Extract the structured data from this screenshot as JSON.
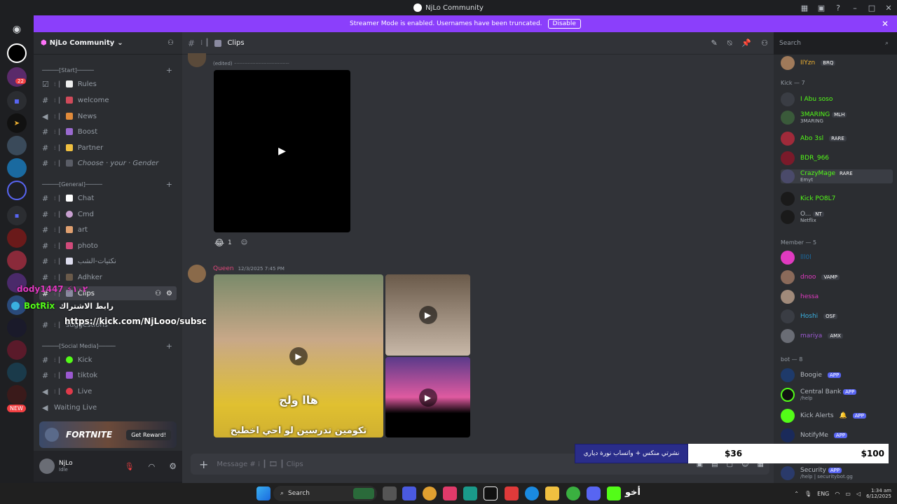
{
  "window": {
    "title": "NjLo Community"
  },
  "banner": {
    "text": "Streamer Mode is enabled. Usernames have been truncated.",
    "button": "Disable"
  },
  "server": {
    "name": "NjLo Community"
  },
  "categories": {
    "start": "─────[Start]─────",
    "general": "─────[General]─────",
    "social": "─────[Social Media]─────"
  },
  "channels": {
    "rules": "Rules",
    "welcome": "welcome",
    "news": "News",
    "boost": "Boost",
    "partner": "Partner",
    "choose": "Choose · your · Gender",
    "chat": "Chat",
    "cmd": "Cmd",
    "art": "art",
    "photo": "photo",
    "memes": "نكتيات-الشب",
    "adhker": "Adhker",
    "clips": "Clips",
    "suggestions": "suggestions",
    "kick": "Kick",
    "tiktok": "tiktok",
    "live": "Live",
    "waiting": "Waiting Live"
  },
  "promo": {
    "game": "FORTNITE",
    "button": "Get Reward!"
  },
  "user": {
    "name": "NjLo",
    "status": "Idle"
  },
  "header": {
    "channel": "Clips"
  },
  "search": {
    "placeholder": "Search"
  },
  "messages": {
    "edited": "(edited)",
    "reaction_count": "1",
    "author": "Queen",
    "timestamp": "12/3/2025 7:45 PM",
    "arabic_caption": "هاا ولج",
    "arabic_caption2": "تكومين تدرسين لو احي اخطبح"
  },
  "compose": {
    "placeholder": "Message # ⁞ ┃ 🎞 ┃ Clips"
  },
  "stream_overlay": {
    "user1": "dody1447 ⚡١٠٢",
    "user2": "BotRix",
    "user2_label": "رابط الاشتراك",
    "link": "https://kick.com/NjLooo/subsc",
    "donation_text": "نشرتي منكس + واتساب نورة دياري",
    "donation_current": "$36",
    "donation_goal": "$100"
  },
  "members": {
    "top": {
      "name": "IIYzn",
      "tag": "BRQ"
    },
    "kick_group": "Kick — 7",
    "kick": [
      {
        "name": "I Abu soso"
      },
      {
        "name": "3MARING",
        "tag": "MLH",
        "sub": "3MARING"
      },
      {
        "name": "Abo 3sl",
        "tag": "RARE"
      },
      {
        "name": "BDR_966"
      },
      {
        "name": "CrazyMage",
        "tag": "RARE",
        "sub": "Emyt"
      },
      {
        "name": "Kick PO8L7"
      },
      {
        "name": "O...",
        "tag": "NT",
        "sub": "Netflix"
      }
    ],
    "member_group": "Member — 5",
    "member": [
      {
        "name": "lll0l"
      },
      {
        "name": "dnoo",
        "tag": "VAMP"
      },
      {
        "name": "hessa"
      },
      {
        "name": "Hoshi",
        "tag": "OSF"
      },
      {
        "name": "mariya",
        "tag": "AMX"
      }
    ],
    "bot_group": "bot — 8",
    "bots": [
      {
        "name": "Boogie",
        "tag": "APP"
      },
      {
        "name": "Central Bank",
        "tag": "APP",
        "sub": "/help"
      },
      {
        "name": "Kick Alerts",
        "tag": "APP"
      },
      {
        "name": "NotifyMe",
        "tag": "APP"
      },
      {
        "name": "Security",
        "tag": "APP",
        "sub": "/help | securitybot.gg"
      }
    ]
  },
  "taskbar": {
    "search": "Search",
    "lang": "ENG",
    "time": "1:34 am",
    "date": "6/12/2025",
    "app_text": "أخو"
  }
}
